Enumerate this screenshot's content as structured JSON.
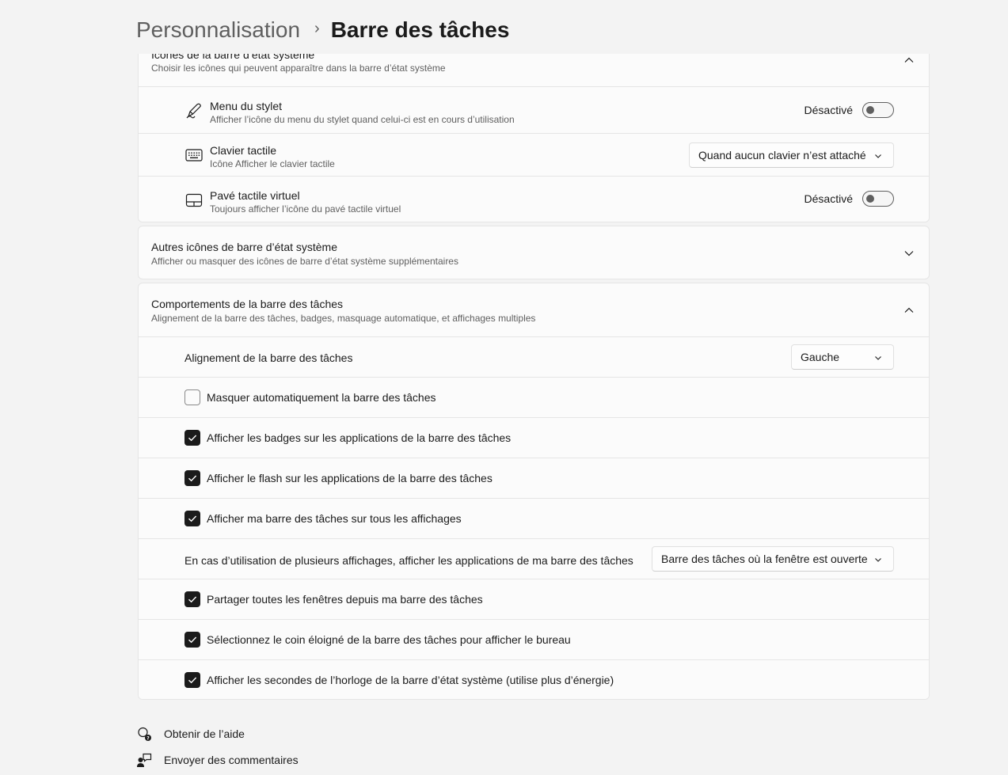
{
  "breadcrumb": {
    "parent": "Personnalisation",
    "separator": "›",
    "current": "Barre des tâches"
  },
  "system_tray_icons": {
    "title": "Icônes de la barre d’état système",
    "subtitle": "Choisir les icônes qui peuvent apparaître dans la barre d’état système",
    "expanded": true,
    "items": [
      {
        "icon": "pen-icon",
        "title": "Menu du stylet",
        "subtitle": "Afficher l’icône du menu du stylet quand celui-ci est en cours d’utilisation",
        "control": "toggle",
        "state_label": "Désactivé",
        "on": false
      },
      {
        "icon": "keyboard-icon",
        "title": "Clavier tactile",
        "subtitle": "Icône Afficher le clavier tactile",
        "control": "dropdown",
        "value": "Quand aucun clavier n’est attaché"
      },
      {
        "icon": "touchpad-icon",
        "title": "Pavé tactile virtuel",
        "subtitle": "Toujours afficher l’icône du pavé tactile virtuel",
        "control": "toggle",
        "state_label": "Désactivé",
        "on": false
      }
    ]
  },
  "other_tray_icons": {
    "title": "Autres icônes de barre d’état système",
    "subtitle": "Afficher ou masquer des icônes de barre d’état système supplémentaires",
    "expanded": false
  },
  "taskbar_behaviors": {
    "title": "Comportements de la barre des tâches",
    "subtitle": "Alignement de la barre des tâches, badges, masquage automatique, et affichages multiples",
    "expanded": true,
    "alignment": {
      "label": "Alignement de la barre des tâches",
      "value": "Gauche"
    },
    "auto_hide": {
      "label": "Masquer automatiquement la barre des tâches",
      "checked": false
    },
    "badges": {
      "label": "Afficher les badges sur les applications de la barre des tâches",
      "checked": true
    },
    "flashing": {
      "label": "Afficher le flash sur les applications de la barre des tâches",
      "checked": true
    },
    "all_displays": {
      "label": "Afficher ma barre des tâches sur tous les affichages",
      "checked": true
    },
    "multi_display": {
      "label": "En cas d’utilisation de plusieurs affichages, afficher les applications de ma barre des tâches",
      "value": "Barre des tâches où la fenêtre est ouverte"
    },
    "share_windows": {
      "label": "Partager toutes les fenêtres depuis ma barre des tâches",
      "checked": true
    },
    "far_corner": {
      "label": "Sélectionnez le coin éloigné de la barre des tâches pour afficher le bureau",
      "checked": true
    },
    "clock_seconds": {
      "label": "Afficher les secondes de l’horloge de la barre d’état système (utilise plus d’énergie)",
      "checked": true
    }
  },
  "footer": {
    "help": {
      "label": "Obtenir de l’aide",
      "icon": "help-icon"
    },
    "feedback": {
      "label": "Envoyer des commentaires",
      "icon": "feedback-icon"
    }
  },
  "colors": {
    "background": "#f3f3f3",
    "card": "#fbfbfb",
    "border": "#e5e5e5",
    "text_primary": "#1b1b1b",
    "text_secondary": "#5f5f5f",
    "checkbox_on": "#1b1b1b"
  }
}
